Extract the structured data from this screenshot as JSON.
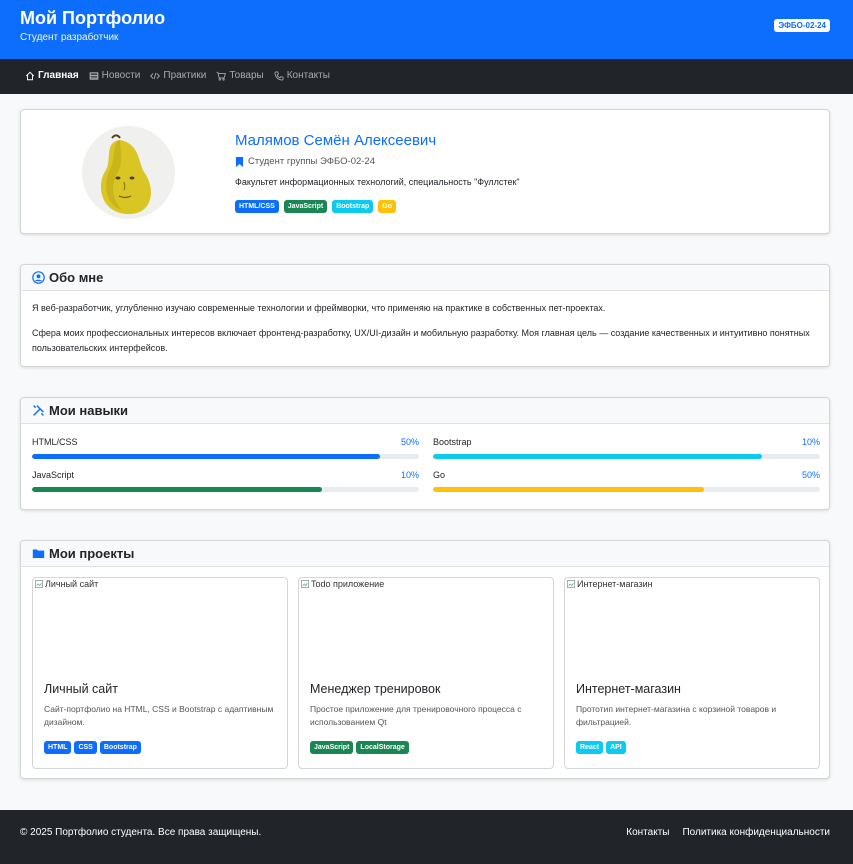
{
  "header": {
    "title": "Мой Портфолио",
    "subtitle": "Студент разработчик",
    "badge": "ЭФБО-02-24"
  },
  "nav": {
    "items": [
      {
        "label": "Главная",
        "icon": "home-icon",
        "active": true
      },
      {
        "label": "Новости",
        "icon": "newspaper-icon"
      },
      {
        "label": "Практики",
        "icon": "code-icon"
      },
      {
        "label": "Товары",
        "icon": "cart-icon"
      },
      {
        "label": "Контакты",
        "icon": "phone-icon"
      }
    ]
  },
  "profile": {
    "name": "Малямов Семён Алексеевич",
    "group": "Студент группы ЭФБО-02-24",
    "faculty": "Факультет информационных технологий, специальность \"Фуллстек\"",
    "tags": [
      {
        "label": "HTML/CSS",
        "color": "#0d6efd"
      },
      {
        "label": "JavaScript",
        "color": "#198754"
      },
      {
        "label": "Bootstrap",
        "color": "#0dcaf0"
      },
      {
        "label": "Go",
        "color": "#ffc107"
      }
    ]
  },
  "about": {
    "title": "Обо мне",
    "p1": "Я веб-разработчик, углубленно изучаю современные технологии и фреймворки, что применяю на практике в собственных пет-проектах.",
    "p2": "Сфера моих профессиональных интересов включает фронтенд-разработку, UX/UI-дизайн и мобильную разработку. Моя главная цель — создание качественных и интуитивно понятных пользовательских интерфейсов."
  },
  "skills": {
    "title": "Мои навыки",
    "items": [
      {
        "name": "HTML/CSS",
        "pct": "50%",
        "level": 0.9,
        "color": "#0d6efd"
      },
      {
        "name": "Bootstrap",
        "pct": "10%",
        "level": 0.85,
        "color": "#0dcaf0"
      },
      {
        "name": "JavaScript",
        "pct": "10%",
        "level": 0.75,
        "color": "#198754"
      },
      {
        "name": "Go",
        "pct": "50%",
        "level": 0.7,
        "color": "#ffc107"
      }
    ]
  },
  "projects": {
    "title": "Мои проекты",
    "items": [
      {
        "alt": "Личный сайт",
        "title": "Личный сайт",
        "desc": "Сайт-портфолио на HTML, CSS и Bootstrap с адаптивным дизайном.",
        "tags": [
          {
            "label": "HTML",
            "color": "#0d6efd"
          },
          {
            "label": "CSS",
            "color": "#0d6efd"
          },
          {
            "label": "Bootstrap",
            "color": "#0d6efd"
          }
        ]
      },
      {
        "alt": "Todo приложение",
        "title": "Менеджер тренировок",
        "desc": "Простое приложение для тренировочного процесса с использованием Qt",
        "tags": [
          {
            "label": "JavaScript",
            "color": "#198754"
          },
          {
            "label": "LocalStorage",
            "color": "#198754"
          }
        ]
      },
      {
        "alt": "Интернет-магазин",
        "title": "Интернет-магазин",
        "desc": "Прототип интернет-магазина с корзиной товаров и фильтрацией.",
        "tags": [
          {
            "label": "React",
            "color": "#0dcaf0"
          },
          {
            "label": "API",
            "color": "#0dcaf0"
          }
        ]
      }
    ]
  },
  "footer": {
    "copyright": "© 2025 Портфолио студента. Все права защищены.",
    "links": [
      "Контакты",
      "Политика конфиденциальности"
    ]
  }
}
